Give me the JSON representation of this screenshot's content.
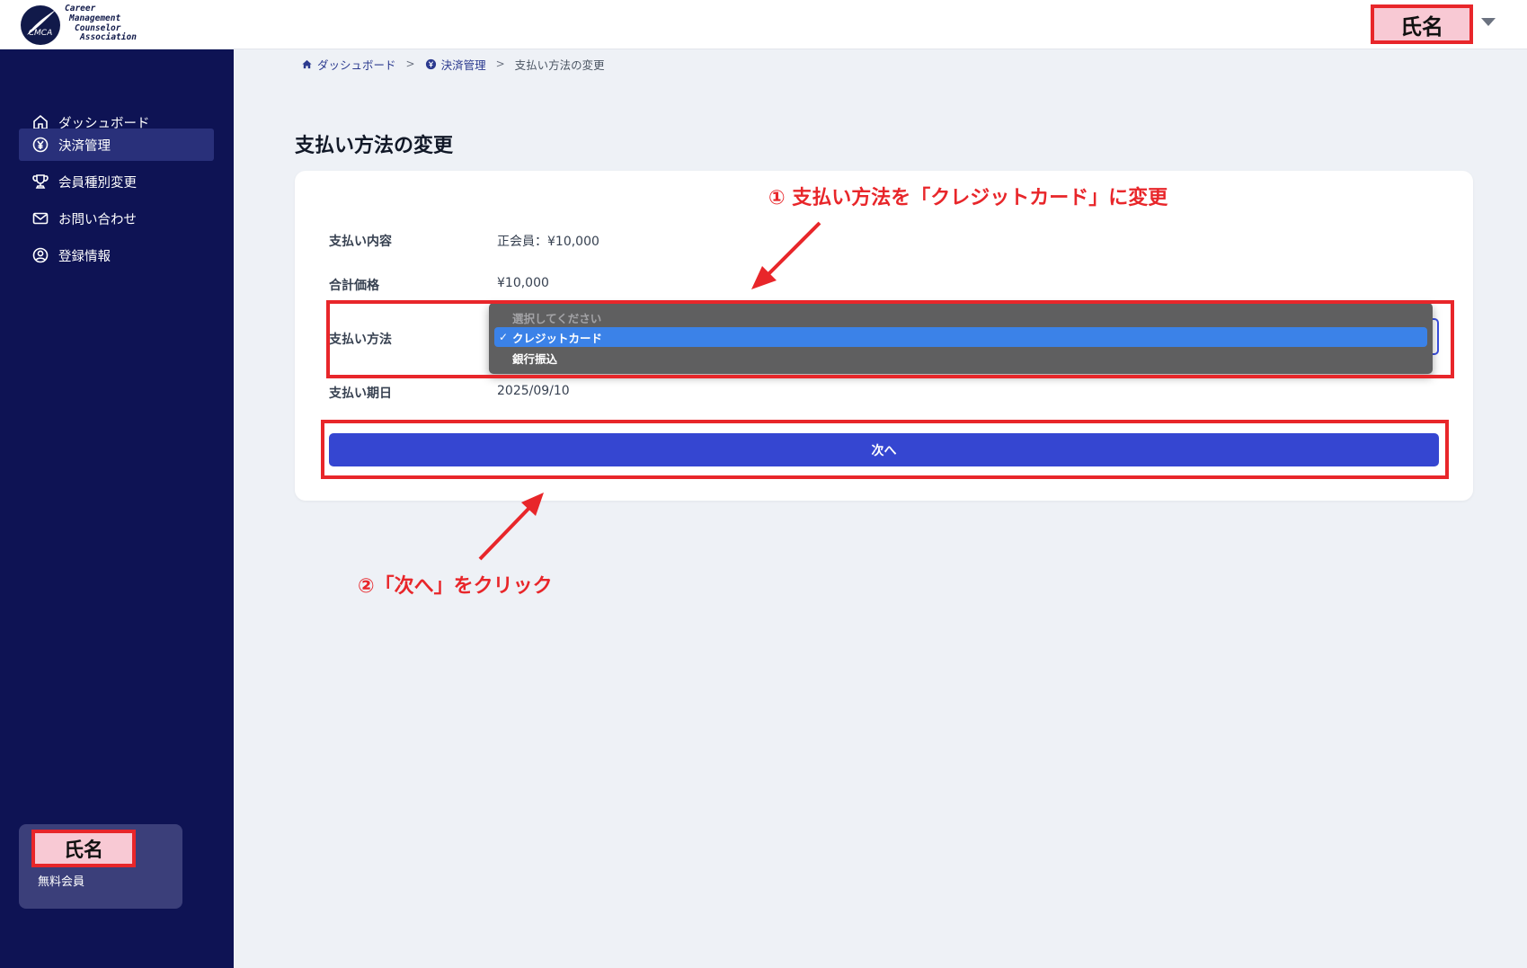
{
  "brand": {
    "logo_mark": "CMCA",
    "logo_lines": [
      "Career",
      "Management",
      "Counselor",
      "Association"
    ]
  },
  "header": {
    "user_name": "氏名",
    "menu_icon": "caret-down-icon"
  },
  "sidebar": {
    "items": [
      {
        "label": "ダッシュボード",
        "icon": "home-icon"
      },
      {
        "label": "決済管理",
        "icon": "yen-icon",
        "active": true
      },
      {
        "label": "会員種別変更",
        "icon": "trophy-icon"
      },
      {
        "label": "お問い合わせ",
        "icon": "mail-icon"
      },
      {
        "label": "登録情報",
        "icon": "user-circle-icon"
      }
    ],
    "user_card": {
      "name": "氏名",
      "status": "無料会員"
    }
  },
  "breadcrumb": {
    "items": [
      {
        "label": "ダッシュボード",
        "icon": "home-icon"
      },
      {
        "label": "決済管理",
        "icon": "yen-icon"
      },
      {
        "label": "支払い方法の変更"
      }
    ],
    "separator": ">"
  },
  "page": {
    "title": "支払い方法の変更"
  },
  "form": {
    "rows": [
      {
        "label": "支払い内容",
        "value": "正会員：¥10,000"
      },
      {
        "label": "合計価格",
        "value": "¥10,000"
      },
      {
        "label": "支払い方法",
        "value": "クレジットカード"
      },
      {
        "label": "支払い期日",
        "value": "2025/09/10"
      }
    ],
    "payment_options": [
      {
        "label": "選択してください",
        "disabled": true
      },
      {
        "label": "クレジットカード",
        "selected": true
      },
      {
        "label": "銀行振込"
      }
    ],
    "check_mark": "✓",
    "next_label": "次へ"
  },
  "annotations": {
    "step1": "① 支払い方法を「クレジットカード」に変更",
    "step2": "②「次へ」をクリック"
  },
  "colors": {
    "sidebar_bg": "#0e1354",
    "sidebar_active": "#29307a",
    "primary_button": "#3546d1",
    "annotation_red": "#e8262a",
    "name_highlight": "#f8c9d4",
    "dropdown_bg": "#5f5f60",
    "dropdown_selected": "#3b82e8"
  }
}
